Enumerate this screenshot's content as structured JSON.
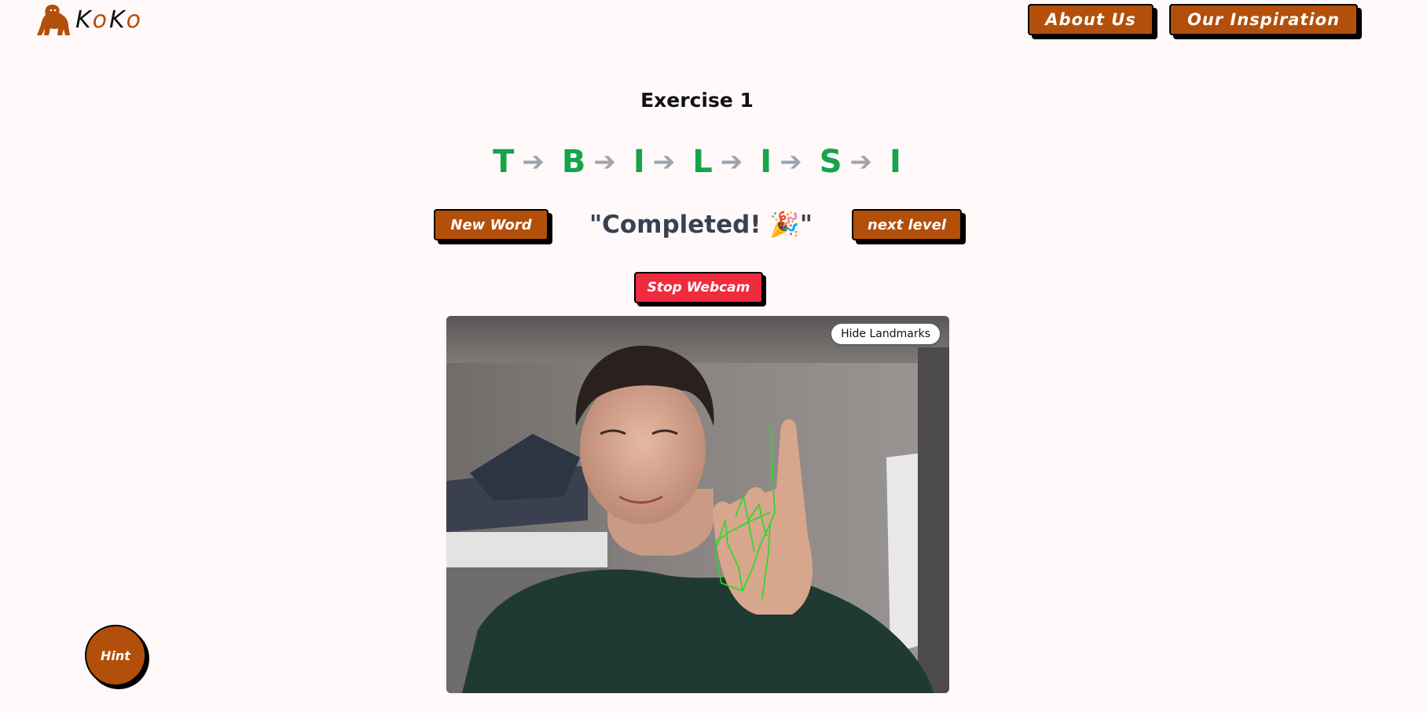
{
  "brand": {
    "logo_parts": [
      "K",
      "o",
      "K",
      "o"
    ]
  },
  "nav": {
    "about_label": "About Us",
    "inspiration_label": "Our Inspiration"
  },
  "exercise": {
    "title": "Exercise 1",
    "letters": [
      "T",
      "B",
      "I",
      "L",
      "I",
      "S",
      "I"
    ],
    "arrow_glyph": "➔",
    "status_text": "\"Completed! 🎉\"",
    "new_word_label": "New Word",
    "next_level_label": "next level"
  },
  "webcam": {
    "stop_label": "Stop Webcam",
    "hide_landmarks_label": "Hide Landmarks"
  },
  "hint": {
    "label": "Hint"
  },
  "colors": {
    "brand_brown": "#b24f0a",
    "letter_green": "#16a34a",
    "arrow_gray": "#9ca3af",
    "stop_red": "#ef2b3e",
    "landmark_green": "#22dd22",
    "page_bg": "#fffaf9"
  },
  "icons": {
    "logo": "gorilla-icon",
    "arrow": "arrow-right-icon"
  }
}
